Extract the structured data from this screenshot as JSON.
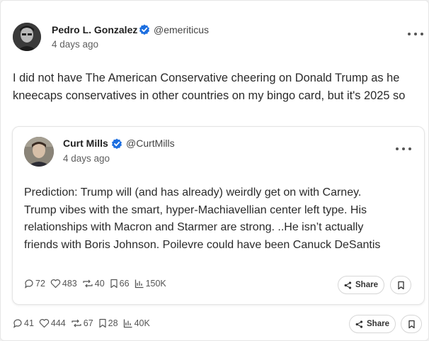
{
  "post": {
    "author_name": "Pedro L. Gonzalez",
    "handle": "@emeriticus",
    "time": "4 days ago",
    "text_lines": [
      "I did not have The American Conservative cheering on Donald Trump as he",
      "kneecaps conservatives in other countries on my bingo card, but it's 2025 so"
    ],
    "stats": {
      "replies": "41",
      "likes": "444",
      "reposts": "67",
      "bookmarks": "28",
      "views": "40K"
    },
    "share_label": "Share"
  },
  "quoted": {
    "author_name": "Curt Mills",
    "handle": "@CurtMills",
    "time": "4 days ago",
    "text_lines": [
      "Prediction: Trump will (and has already) weirdly get on with Carney.",
      "Trump vibes with the smart, hyper-Machiavellian center left type. His",
      "relationships with Macron and Starmer are strong. ..He isn’t actually",
      "friends with Boris Johnson. Poilevre could have been Canuck DeSantis"
    ],
    "stats": {
      "replies": "72",
      "likes": "483",
      "reposts": "40",
      "bookmarks": "66",
      "views": "150K"
    },
    "share_label": "Share"
  },
  "colors": {
    "verified": "#1d6fe0",
    "icon": "#555555",
    "text": "#2a2a2a"
  },
  "icons": [
    "verified-badge-icon",
    "more-icon",
    "reply-icon",
    "like-icon",
    "repost-icon",
    "bookmark-icon",
    "views-icon",
    "share-icon"
  ]
}
